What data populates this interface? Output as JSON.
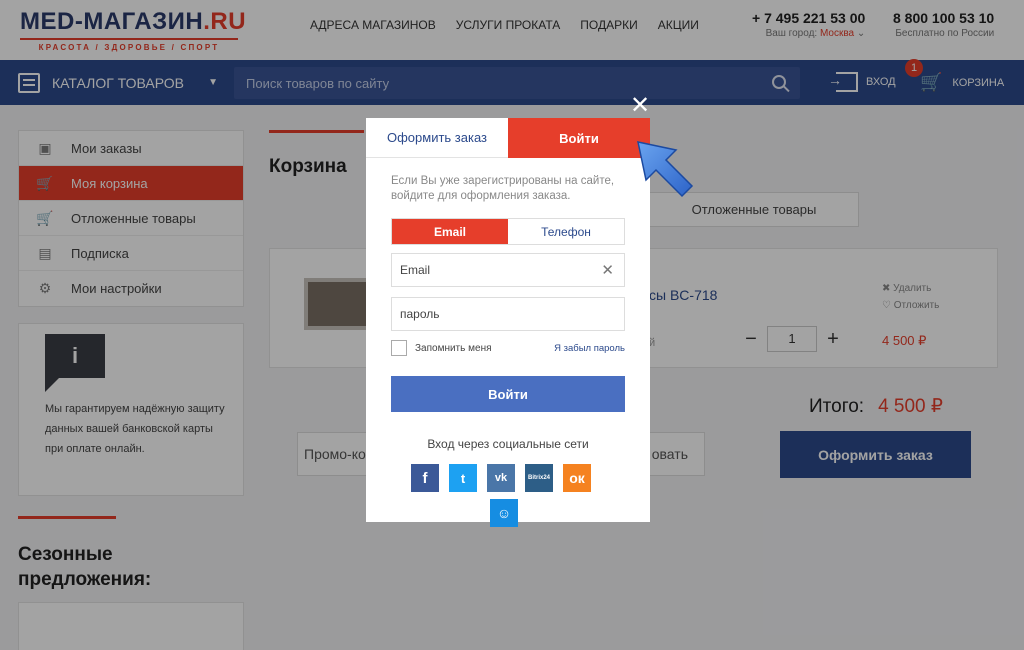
{
  "header": {
    "logo_main": "MED-МАГАЗИН",
    "logo_tld": ".RU",
    "logo_tagline": "КРАСОТА / ЗДОРОВЬЕ / СПОРТ",
    "nav": [
      "АДРЕСА МАГАЗИНОВ",
      "УСЛУГИ ПРОКАТА",
      "ПОДАРКИ",
      "АКЦИИ"
    ],
    "phone1": "+ 7 495 221 53 00",
    "city_label": "Ваш город:",
    "city": "Москва",
    "phone2": "8 800 100 53 10",
    "phone2_note": "Бесплатно по России"
  },
  "navbar": {
    "catalog": "КАТАЛОГ ТОВАРОВ",
    "search_placeholder": "Поиск товаров по сайту",
    "login": "ВХОД",
    "cart": "КОРЗИНА",
    "cart_count": "1"
  },
  "sidebar": {
    "items": [
      {
        "label": "Мои заказы",
        "icon": "box-icon"
      },
      {
        "label": "Моя корзина",
        "icon": "cart-icon",
        "active": true
      },
      {
        "label": "Отложенные товары",
        "icon": "cart-icon"
      },
      {
        "label": "Подписка",
        "icon": "document-icon"
      },
      {
        "label": "Мои настройки",
        "icon": "gear-icon"
      }
    ],
    "guarantee_icon": "i",
    "guarantee_text": "Мы гарантируем надёжную защиту данных вашей банковской карты при оплате онлайн.",
    "season_title_line1": "Сезонные",
    "season_title_line2": "предложения:"
  },
  "main": {
    "title": "Корзина",
    "deferred_tab": "Отложенные товары",
    "product_name": "сы BC-718",
    "product_avail": "й",
    "remove": "Удалить",
    "postpone": "Отложить",
    "qty": "1",
    "price": "4 500 ₽",
    "total_label": "Итого:",
    "total_value": "4 500 ₽",
    "promo_left": "Промо-ко",
    "promo_right": "овать",
    "checkout": "Оформить заказ"
  },
  "modal": {
    "tab_order": "Оформить заказ",
    "tab_login": "Войти",
    "info": "Если Вы уже зарегистрированы на сайте, войдите для оформления заказа.",
    "switch_email": "Email",
    "switch_phone": "Телефон",
    "email_placeholder": "Email",
    "password_placeholder": "пароль",
    "remember": "Запомнить меня",
    "forgot": "Я забыл пароль",
    "submit": "Войти",
    "social_title": "Вход через социальные сети",
    "social": {
      "fb": "f",
      "tw": "t",
      "vk": "vk",
      "bx": "Bitrix24",
      "ok": "ок",
      "mm": "☺"
    },
    "close": "✕"
  },
  "colors": {
    "accent": "#e63e2b",
    "brand": "#2c4a8c"
  }
}
